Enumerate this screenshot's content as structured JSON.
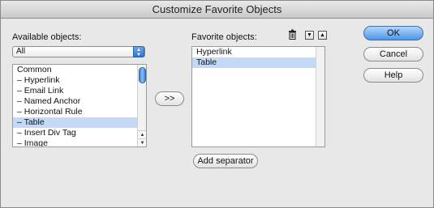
{
  "window": {
    "title": "Customize Favorite Objects"
  },
  "available": {
    "label": "Available objects:",
    "dropdown_value": "All",
    "items": [
      {
        "label": "Common"
      },
      {
        "label": "– Hyperlink"
      },
      {
        "label": "– Email Link"
      },
      {
        "label": "– Named Anchor"
      },
      {
        "label": "– Horizontal Rule"
      },
      {
        "label": "– Table",
        "selected": true
      },
      {
        "label": "– Insert Div Tag"
      },
      {
        "label": "– Image"
      }
    ]
  },
  "move_button": {
    "label": ">>"
  },
  "favorites": {
    "label": "Favorite objects:",
    "items": [
      {
        "label": "Hyperlink"
      },
      {
        "label": "Table",
        "selected": true
      }
    ]
  },
  "add_separator": {
    "label": "Add separator"
  },
  "buttons": {
    "ok": "OK",
    "cancel": "Cancel",
    "help": "Help"
  }
}
